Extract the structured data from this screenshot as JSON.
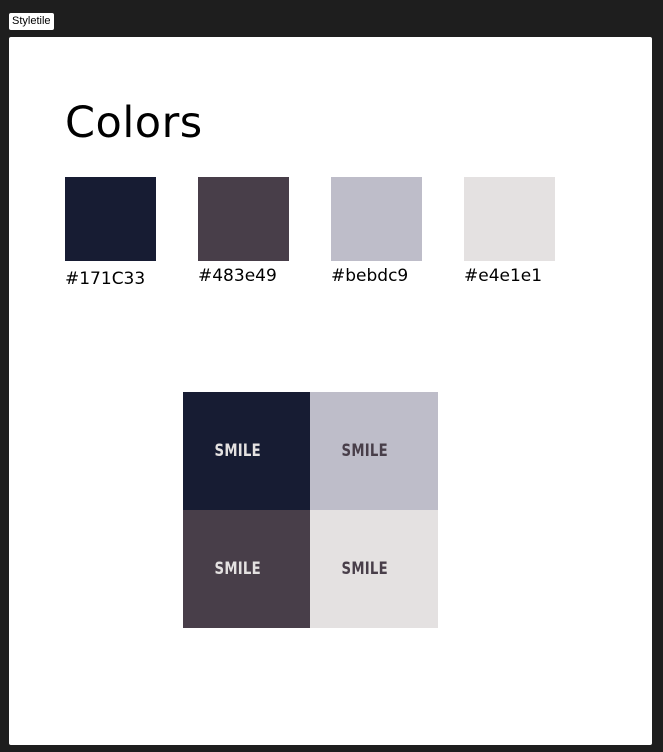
{
  "tab": {
    "label": "Styletile"
  },
  "page": {
    "heading": "Colors"
  },
  "swatches": [
    {
      "label": "#171C33",
      "color": "#171c33"
    },
    {
      "label": "#483e49",
      "color": "#483e49"
    },
    {
      "label": "#bebdc9",
      "color": "#bebdc9"
    },
    {
      "label": "#e4e1e1",
      "color": "#e4e1e1"
    }
  ],
  "sample_grid": [
    {
      "text": "SMILE",
      "background": "#171c33",
      "text_color": "#e4e1e1"
    },
    {
      "text": "SMILE",
      "background": "#bebdc9",
      "text_color": "#483e49"
    },
    {
      "text": "SMILE",
      "background": "#483e49",
      "text_color": "#e4e1e1"
    },
    {
      "text": "SMILE",
      "background": "#e4e1e1",
      "text_color": "#483e49"
    }
  ]
}
